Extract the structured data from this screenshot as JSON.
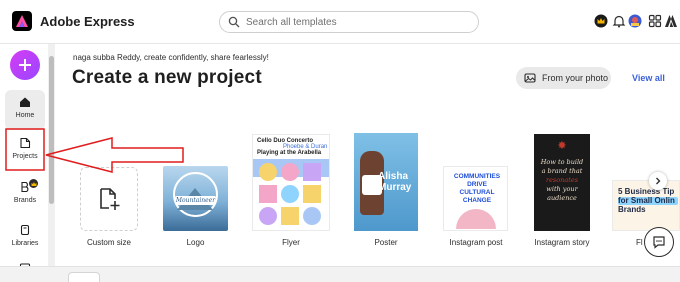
{
  "app": {
    "title": "Adobe Express"
  },
  "search": {
    "placeholder": "Search all templates"
  },
  "topbar_icons": [
    "crown-icon",
    "bell-icon",
    "avatar",
    "apps-grid-icon",
    "adobe-icon"
  ],
  "sidebar": {
    "items": [
      {
        "label": "Home",
        "icon": "home-icon"
      },
      {
        "label": "Projects",
        "icon": "projects-icon"
      },
      {
        "label": "Brands",
        "icon": "brands-icon"
      },
      {
        "label": "Libraries",
        "icon": "libraries-icon"
      }
    ]
  },
  "main": {
    "greeting": "naga subba Reddy, create confidently, share fearlessly!",
    "title": "Create a new project",
    "from_photo_label": "From your photo",
    "view_all_label": "View all"
  },
  "templates": [
    {
      "label": "Custom size"
    },
    {
      "label": "Logo",
      "preview": {
        "text": "Mountaineer"
      }
    },
    {
      "label": "Flyer",
      "preview": {
        "line1": "Cello Duo Concerto",
        "line2": "Phoebe & Duran",
        "line3": "Playing at the Arabella"
      }
    },
    {
      "label": "Poster",
      "preview": {
        "name": "Alisha Murray"
      }
    },
    {
      "label": "Instagram post",
      "preview": {
        "text": "COMMUNITIES DRIVE CULTURAL CHANGE"
      }
    },
    {
      "label": "Instagram story",
      "preview": {
        "line1": "How to build",
        "line2": "a brand that",
        "line3": "resonates",
        "line4": "with your",
        "line5": "audience"
      }
    },
    {
      "label": "Fl",
      "preview": {
        "line1": "5 Business Tip",
        "line2": "for Small Onlin",
        "line3": "Brands"
      }
    }
  ],
  "colors": {
    "accent_link": "#3b63d9",
    "create_button": "#b241fa",
    "annotation_arrow": "#e11d1d"
  }
}
